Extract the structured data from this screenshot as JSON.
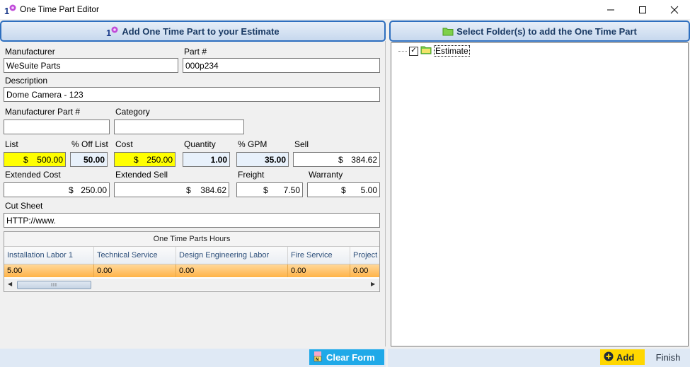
{
  "window": {
    "title": "One Time Part Editor",
    "controls": {
      "minimize": "—",
      "maximize": "☐",
      "close": "✕"
    }
  },
  "left_header": {
    "label": "Add One Time Part to your Estimate",
    "icon": "one-time-part-icon"
  },
  "right_header": {
    "label": "Select Folder(s) to add the One Time Part",
    "icon": "folder-icon"
  },
  "form": {
    "manufacturer": {
      "label": "Manufacturer",
      "value": "WeSuite Parts"
    },
    "part_number": {
      "label": "Part #",
      "value": "000p234"
    },
    "description": {
      "label": "Description",
      "value": "Dome Camera - 123"
    },
    "manufacturer_part": {
      "label": "Manufacturer Part #",
      "value": ""
    },
    "category": {
      "label": "Category",
      "value": ""
    },
    "list": {
      "label": "List",
      "currency": "$",
      "value": "500.00"
    },
    "pct_off_list": {
      "label": "% Off List",
      "value": "50.00"
    },
    "cost": {
      "label": "Cost",
      "currency": "$",
      "value": "250.00"
    },
    "quantity": {
      "label": "Quantity",
      "value": "1.00"
    },
    "pct_gpm": {
      "label": "% GPM",
      "value": "35.00"
    },
    "sell": {
      "label": "Sell",
      "currency": "$",
      "value": "384.62"
    },
    "extended_cost": {
      "label": "Extended Cost",
      "currency": "$",
      "value": "250.00"
    },
    "extended_sell": {
      "label": "Extended Sell",
      "currency": "$",
      "value": "384.62"
    },
    "freight": {
      "label": "Freight",
      "currency": "$",
      "value": "7.50"
    },
    "warranty": {
      "label": "Warranty",
      "currency": "$",
      "value": "5.00"
    },
    "cut_sheet": {
      "label": "Cut Sheet",
      "value": "HTTP://www."
    }
  },
  "hours_grid": {
    "caption": "One Time Parts Hours",
    "columns": [
      "Installation Labor 1",
      "Technical Service",
      "Design Engineering Labor",
      "Fire Service",
      "Project"
    ],
    "row": [
      "5.00",
      "0.00",
      "0.00",
      "0.00",
      "0.00"
    ],
    "scroll_thumb": "III"
  },
  "tree": {
    "root": {
      "label": "Estimate",
      "checked": true,
      "check_glyph": "✓"
    }
  },
  "buttons": {
    "clear_form": "Clear Form",
    "add": "Add",
    "finish": "Finish"
  },
  "colors": {
    "accent": "#2e6fbf",
    "highlight_yellow": "#ffff00",
    "clear_button": "#1fa9e8",
    "add_button": "#ffd700",
    "grid_row": "#ffb347"
  }
}
